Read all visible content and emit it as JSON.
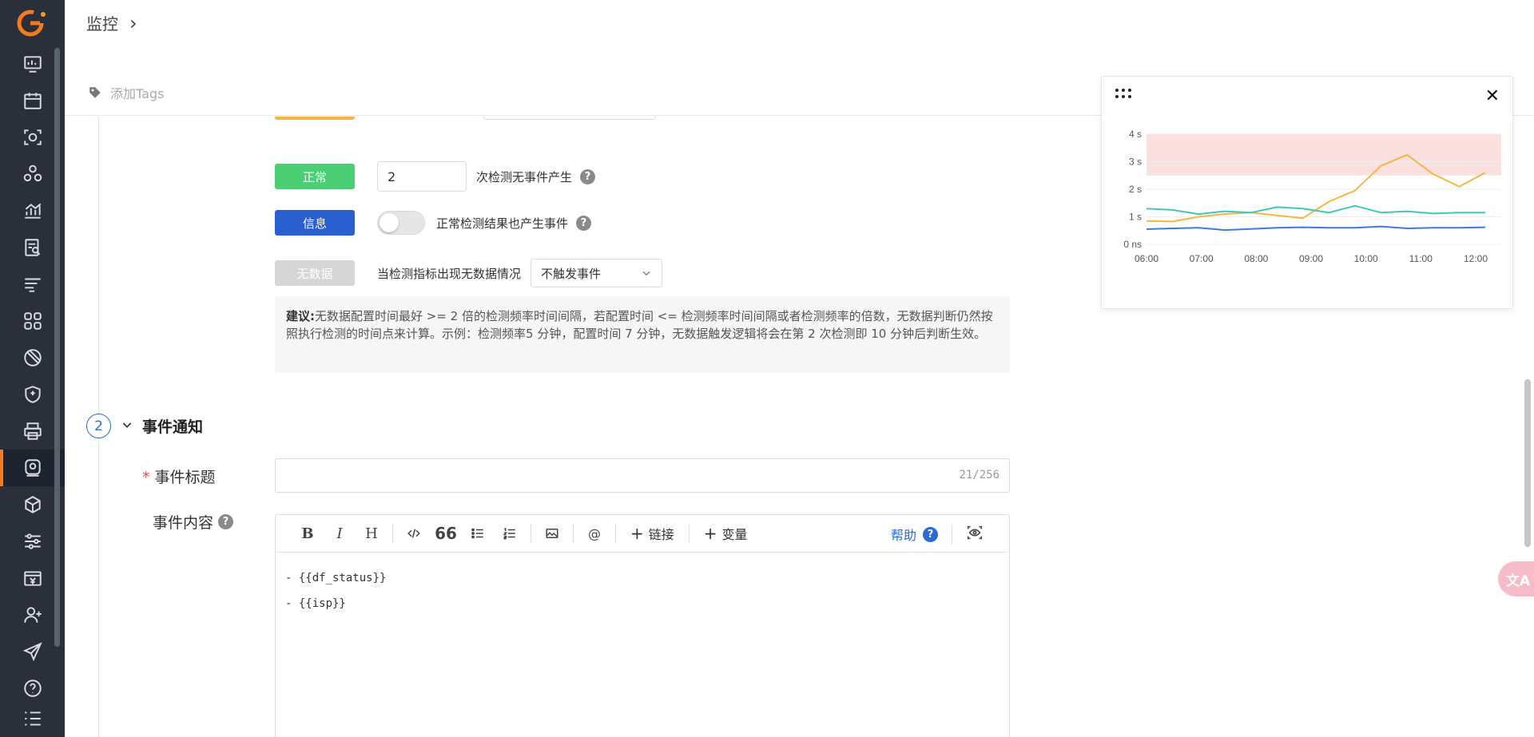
{
  "breadcrumb": {
    "title": "监控",
    "chevron": "›"
  },
  "tags": {
    "placeholder": "添加Tags"
  },
  "levels": {
    "normal": {
      "badge": "正常",
      "value": "2",
      "text": "次检测无事件产生",
      "color": "#4ccf74"
    },
    "info": {
      "badge": "信息",
      "text": "正常检测结果也产生事件",
      "color": "#2a5fd0",
      "toggle_on": false
    },
    "nodata": {
      "badge": "无数据",
      "text": "当检测指标出现无数据情况",
      "select_value": "不触发事件",
      "color": "#d6d6d6"
    }
  },
  "tip": {
    "label": "建议:",
    "text": "无数据配置时间最好 >= 2 倍的检测频率时间间隔，若配置时间 <= 检测频率时间间隔或者检测频率的倍数，无数据判断仍然按照执行检测的时间点来计算。示例：检测频率5 分钟，配置时间 7 分钟，无数据触发逻辑将会在第 2 次检测即 10 分钟后判断生效。"
  },
  "section": {
    "number": "2",
    "title": "事件通知"
  },
  "event_title": {
    "label": "事件标题",
    "required_mark": "*",
    "counter": "21/256"
  },
  "event_content": {
    "label": "事件内容",
    "toolbar": {
      "bold": "B",
      "italic": "I",
      "heading": "H",
      "quote": "66",
      "mention": "@",
      "link": "链接",
      "variable": "变量",
      "help": "帮助"
    },
    "lines": [
      "- {{df_status}}",
      "- {{isp}}"
    ]
  },
  "chart_data": {
    "type": "line",
    "x": [
      "06:00",
      "07:00",
      "08:00",
      "09:00",
      "10:00",
      "11:00",
      "12:00"
    ],
    "yticks": [
      "0 ns",
      "1 s",
      "2 s",
      "3 s",
      "4 s"
    ],
    "ylim": [
      0,
      4
    ],
    "threshold_band": [
      2.5,
      4
    ],
    "series": [
      {
        "color": "#f5b642",
        "values": [
          0.85,
          0.83,
          1.0,
          1.1,
          1.15,
          1.05,
          0.95,
          1.55,
          1.95,
          2.85,
          3.25,
          2.55,
          2.1,
          2.6
        ]
      },
      {
        "color": "#3fc9b5",
        "values": [
          1.3,
          1.25,
          1.1,
          1.2,
          1.15,
          1.35,
          1.3,
          1.15,
          1.4,
          1.15,
          1.2,
          1.12,
          1.15,
          1.15
        ]
      },
      {
        "color": "#3d7be0",
        "values": [
          0.55,
          0.58,
          0.6,
          0.52,
          0.56,
          0.6,
          0.62,
          0.6,
          0.6,
          0.65,
          0.58,
          0.6,
          0.6,
          0.62
        ]
      }
    ]
  }
}
